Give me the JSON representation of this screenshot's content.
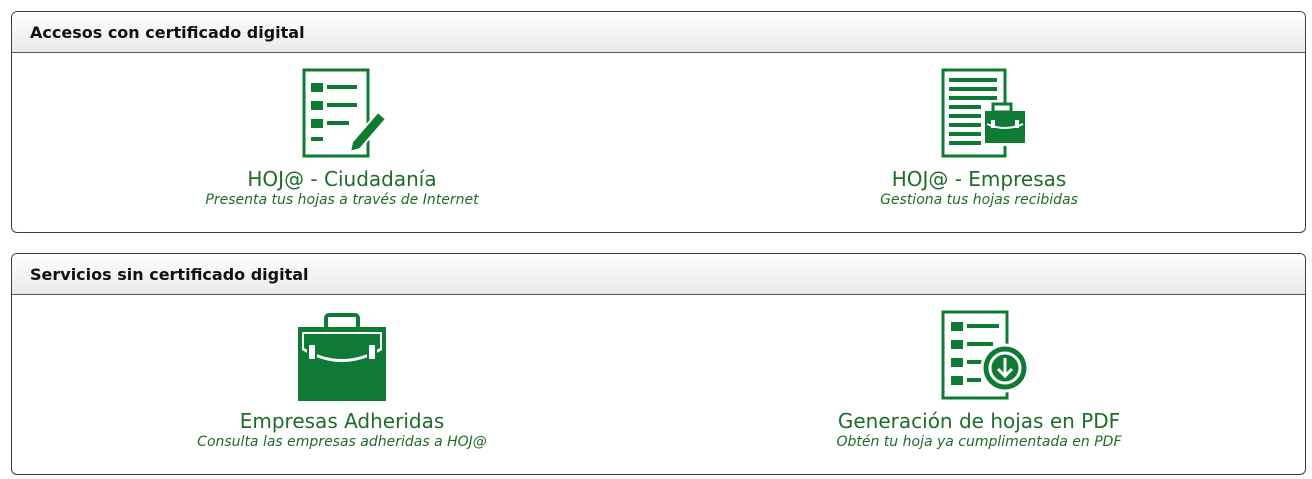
{
  "colors": {
    "accent": "#0f7a33",
    "text_green": "#1f6b2a"
  },
  "sections": [
    {
      "title": "Accesos con certificado digital",
      "tiles": [
        {
          "title": "HOJ@ - Ciudadanía",
          "subtitle": "Presenta tus hojas a través de Internet",
          "icon": "form-pencil-icon"
        },
        {
          "title": "HOJ@ - Empresas",
          "subtitle": "Gestiona tus hojas recibidas",
          "icon": "document-briefcase-icon"
        }
      ]
    },
    {
      "title": "Servicios sin certificado digital",
      "tiles": [
        {
          "title": "Empresas Adheridas",
          "subtitle": "Consulta las empresas adheridas a HOJ@",
          "icon": "briefcase-icon"
        },
        {
          "title": "Generación de hojas en PDF",
          "subtitle": "Obtén tu hoja ya cumplimentada en PDF",
          "icon": "document-download-icon"
        }
      ]
    }
  ]
}
